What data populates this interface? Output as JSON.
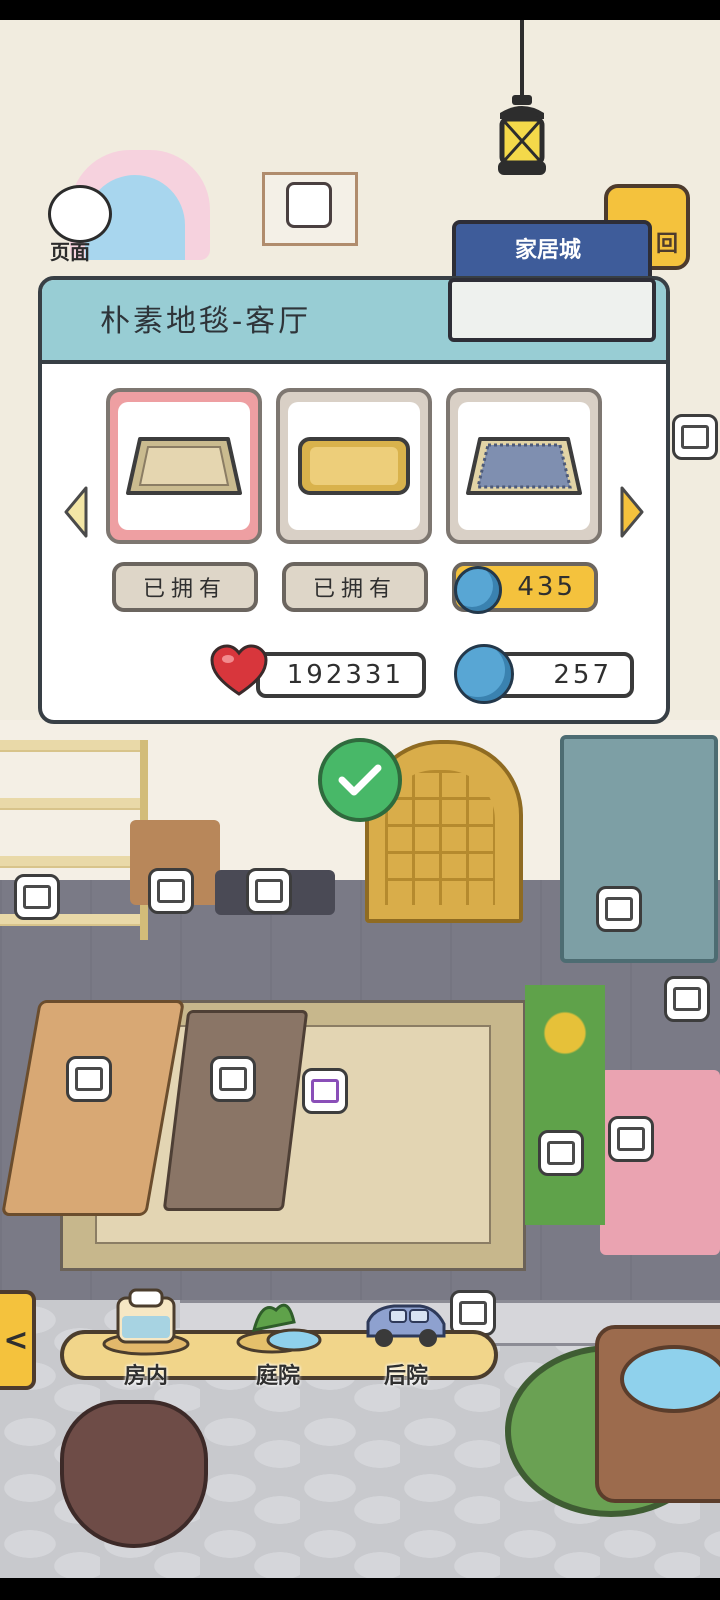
{
  "page_button": {
    "label": "页面",
    "icon": "panda-icon"
  },
  "return_button": {
    "label": "回",
    "icon": "return-arrow-icon"
  },
  "store_sign": {
    "label": "家居城"
  },
  "dialog": {
    "title": "朴素地毯-客厅",
    "items": [
      {
        "name": "beige-rug",
        "status": "已拥有",
        "selected": true,
        "color": "#e5d6b0"
      },
      {
        "name": "yellow-rug",
        "status": "已拥有",
        "selected": false,
        "color": "#edce7a"
      },
      {
        "name": "blue-fringe-rug",
        "price": "435",
        "currency_icon": "clover-coin-icon",
        "selected": false,
        "color": "#7f8fb0"
      }
    ],
    "prev_arrow": "chevron-left-icon",
    "next_arrow": "chevron-right-icon"
  },
  "stats": {
    "hearts": "192331",
    "hearts_icon": "heart-icon",
    "clovers": "257",
    "clovers_icon": "clover-coin-icon"
  },
  "confirm_icon": "checkmark-icon",
  "furniture_tags": [
    "drawer-tag-icon",
    "cabinet-tag-icon",
    "bed-tag-icon",
    "wardrobe-tag-icon",
    "window-tag-icon",
    "chair-tag-icon",
    "table-tag-icon",
    "rug-tag-icon",
    "plant-tag-icon",
    "box-tag-icon",
    "frame-tag-icon",
    "shelf-tag-icon",
    "sign-tag-icon"
  ],
  "side_tab": {
    "label": "<"
  },
  "nav": {
    "items": [
      {
        "label": "房内",
        "icon": "bed-room-icon"
      },
      {
        "label": "庭院",
        "icon": "garden-icon"
      },
      {
        "label": "后院",
        "icon": "car-backyard-icon"
      }
    ]
  },
  "colors": {
    "panel_header": "#98cdd4",
    "accent_yellow": "#f4c23d",
    "selected_pink": "#ee9fa2",
    "confirm_green": "#48b868",
    "coin_blue": "#58a6d4",
    "heart_red": "#d8363c"
  }
}
